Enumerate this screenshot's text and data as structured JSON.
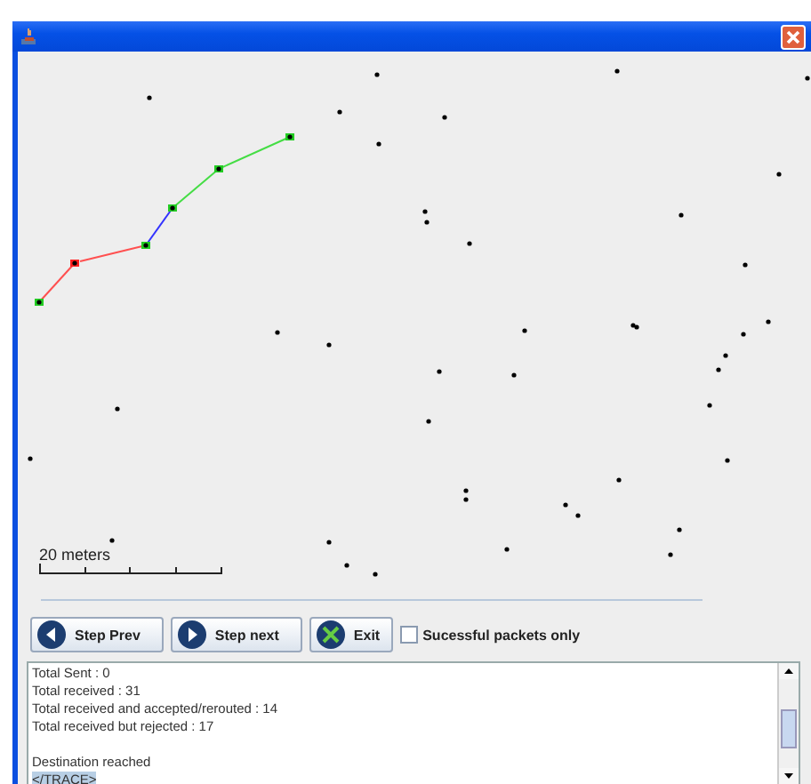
{
  "scale_bar": {
    "label": "20 meters"
  },
  "buttons": [
    {
      "label": "Step Prev",
      "kind": "prev"
    },
    {
      "label": "Step next",
      "kind": "next"
    },
    {
      "label": "Exit",
      "kind": "exit"
    }
  ],
  "filter": {
    "label": "Sucessful packets only",
    "checked": false
  },
  "log": {
    "summary": [
      {
        "text": "Total Sent : 0",
        "highlighted": false
      },
      {
        "text": "Total received : 31",
        "highlighted": false
      },
      {
        "text": "Total received and accepted/rerouted : 14",
        "highlighted": false
      },
      {
        "text": "Total received but rejected : 17",
        "highlighted": false
      }
    ],
    "trace": [
      {
        "text": "Destination reached",
        "highlighted": false
      },
      {
        "text": "</TRACE>",
        "highlighted": true
      }
    ]
  }
}
